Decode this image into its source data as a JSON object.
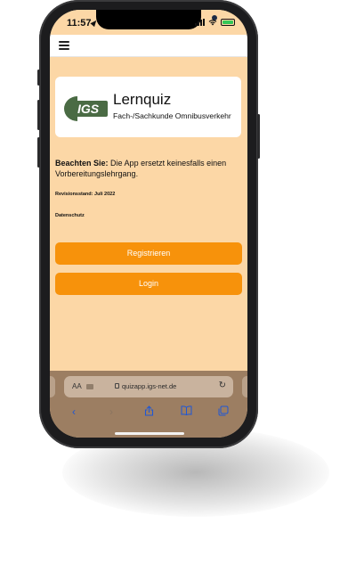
{
  "status_bar": {
    "time": "11:57"
  },
  "header": {
    "menu_icon": "hamburger-icon"
  },
  "logo": {
    "mark_text": "IGS",
    "title": "Lernquiz",
    "subtitle": "Fach-/Sachkunde Omnibusverkehr"
  },
  "notice": {
    "label": "Beachten Sie:",
    "text": "Die App ersetzt keinesfalls einen Vorbereitungslehrgang."
  },
  "revision": "Revisionsstand: Juli 2022",
  "privacy_link": "Datenschutz",
  "buttons": {
    "register": "Registrieren",
    "login": "Login"
  },
  "browser": {
    "aa_label": "AA",
    "url": "quizapp.igs-net.de",
    "icons": [
      "back-icon",
      "forward-icon",
      "share-icon",
      "bookmarks-icon",
      "tabs-icon",
      "reload-icon",
      "lock-icon"
    ]
  },
  "colors": {
    "background": "#fcd7a6",
    "accent": "#f7920b",
    "link": "#1e57d6",
    "logo_green": "#4a6b44"
  }
}
